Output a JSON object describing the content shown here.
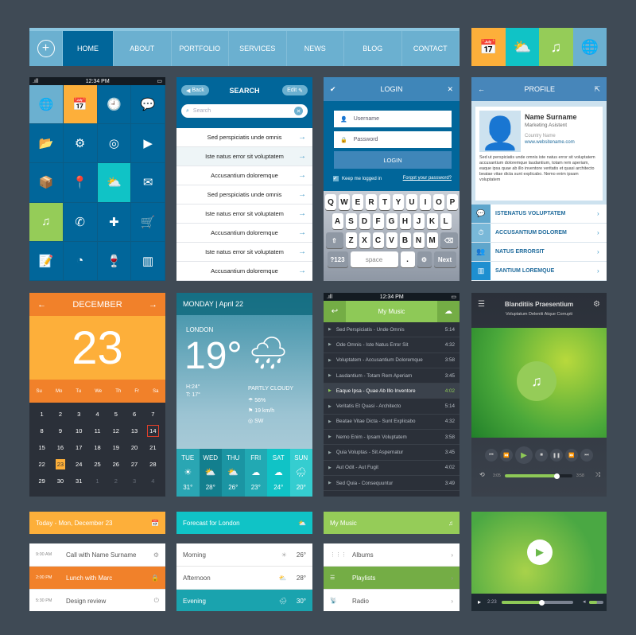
{
  "nav": {
    "items": [
      {
        "label": "HOME",
        "active": true
      },
      {
        "label": "ABOUT"
      },
      {
        "label": "PORTFOLIO"
      },
      {
        "label": "SERVICES"
      },
      {
        "label": "NEWS"
      },
      {
        "label": "BLOG"
      },
      {
        "label": "CONTACT"
      }
    ],
    "plus_icon": "+"
  },
  "tiles": [
    {
      "icon": "calendar-icon",
      "glyph": "📅",
      "color": "#fdaf3a"
    },
    {
      "icon": "weather-icon",
      "glyph": "⛅",
      "color": "#10c3c6"
    },
    {
      "icon": "music-icon",
      "glyph": "♫",
      "color": "#95cc58"
    },
    {
      "icon": "globe-icon",
      "glyph": "🌐",
      "color": "#6bb0d0"
    }
  ],
  "phone": {
    "time": "12:34 PM",
    "signal": ".ıll",
    "battery": "▭"
  },
  "grid_apps": [
    {
      "name": "globe",
      "glyph": "🌐",
      "color": "#6bb0d0"
    },
    {
      "name": "calendar",
      "glyph": "📅",
      "color": "#fdaf3a"
    },
    {
      "name": "clock",
      "glyph": "🕘"
    },
    {
      "name": "chat",
      "glyph": "💬"
    },
    {
      "name": "folder",
      "glyph": "📂"
    },
    {
      "name": "settings",
      "glyph": "⚙"
    },
    {
      "name": "target",
      "glyph": "◎"
    },
    {
      "name": "video",
      "glyph": "▶"
    },
    {
      "name": "box",
      "glyph": "📦"
    },
    {
      "name": "location",
      "glyph": "📍"
    },
    {
      "name": "weather",
      "glyph": "⛅",
      "color": "#10c3c6"
    },
    {
      "name": "mail",
      "glyph": "✉"
    },
    {
      "name": "music",
      "glyph": "♫",
      "color": "#95cc58"
    },
    {
      "name": "phone",
      "glyph": "✆"
    },
    {
      "name": "medkit",
      "glyph": "✚"
    },
    {
      "name": "cart",
      "glyph": "🛒"
    },
    {
      "name": "notes",
      "glyph": "📝"
    },
    {
      "name": "pie-chart",
      "glyph": "◔"
    },
    {
      "name": "wine",
      "glyph": "🍷"
    },
    {
      "name": "bar-chart",
      "glyph": "▥"
    }
  ],
  "search": {
    "back_label": "Back",
    "title": "SEARCH",
    "edit_label": "Edit",
    "placeholder": "Search",
    "results": [
      "Sed perspiciatis unde omnis",
      "Iste natus error sit voluptatem",
      "Accusantium doloremque",
      "Sed perspiciatis unde omnis",
      "Iste natus error sit voluptatem",
      "Accusantium doloremque",
      "Iste natus error sit voluptatem",
      "Accusantium doloremque"
    ]
  },
  "login": {
    "title": "LOGIN",
    "username_placeholder": "Username",
    "password_placeholder": "Password",
    "button": "LOGIN",
    "keep_logged": "Keep me logged in",
    "forgot": "Forgot your password?",
    "keyboard": {
      "row1": [
        "Q",
        "W",
        "E",
        "R",
        "T",
        "Y",
        "U",
        "I",
        "O",
        "P"
      ],
      "row2": [
        "A",
        "S",
        "D",
        "F",
        "G",
        "H",
        "J",
        "K",
        "L"
      ],
      "row3": [
        "Z",
        "X",
        "C",
        "V",
        "B",
        "N",
        "M"
      ],
      "num": "?123",
      "space": "space",
      "dot": ".",
      "next": "Next"
    }
  },
  "profile": {
    "title": "PROFILE",
    "name": "Name Surname",
    "role": "Marketing Asistent",
    "country": "Country Name",
    "website": "www.websitename.com",
    "bio": "Sed ut perspiciatis unde omnis iste natus error sit voluptatem accusantium doloremque laudantium, totam rem aperiam, eaque ipsa quae ab illo inventore veritatis et quasi architecto beatae vitae dicta sunt explicabo. Nemo enim ipsam voluptatem",
    "links": [
      {
        "label": "ISTENATUS VOLUPTATEM",
        "glyph": "💬",
        "color": "#5fa6cc"
      },
      {
        "label": "ACCUSANTIUM DOLOREM",
        "glyph": "⏱",
        "color": "#79b8d8"
      },
      {
        "label": "NATUS ERRORSIT",
        "glyph": "👥",
        "color": "#5fa6cc"
      },
      {
        "label": "SANTIUM LOREMQUE",
        "glyph": "▥",
        "color": "#1e8fd0"
      }
    ]
  },
  "calendar": {
    "month": "DECEMBER",
    "day": "23",
    "weekdays": [
      "Su",
      "Mo",
      "Tu",
      "We",
      "Th",
      "Fr",
      "Sa"
    ],
    "days": [
      "1",
      "2",
      "3",
      "4",
      "5",
      "6",
      "7",
      "8",
      "9",
      "10",
      "11",
      "12",
      "13",
      "14",
      "15",
      "16",
      "17",
      "18",
      "19",
      "20",
      "21",
      "22",
      "23",
      "24",
      "25",
      "26",
      "27",
      "28",
      "29",
      "30",
      "31",
      "1",
      "2",
      "3",
      "4"
    ],
    "selected": "23",
    "marked": "14"
  },
  "weather": {
    "header": "MONDAY | April 22",
    "city": "LONDON",
    "temp": "19°",
    "high": "H:24°",
    "low": "T: 17°",
    "condition": "PARTLY CLOUDY",
    "humidity": "56%",
    "wind": "19 km/h",
    "direction": "SW",
    "forecast": [
      {
        "day": "TUE",
        "temp": "31°",
        "glyph": "☀",
        "color": "#2aa6b3"
      },
      {
        "day": "WED",
        "temp": "28°",
        "glyph": "⛅",
        "color": "#137f8e"
      },
      {
        "day": "THU",
        "temp": "26°",
        "glyph": "⛅",
        "color": "#1b95a3"
      },
      {
        "day": "FRI",
        "temp": "23°",
        "glyph": "☁",
        "color": "#22a9b3"
      },
      {
        "day": "SAT",
        "temp": "24°",
        "glyph": "☁",
        "color": "#10c3c6"
      },
      {
        "day": "SUN",
        "temp": "20°",
        "glyph": "🌧",
        "color": "#35cdd0"
      }
    ]
  },
  "music": {
    "title": "My Music",
    "time": "12:34 PM",
    "tracks": [
      {
        "t": "Sed Perspiciatis - Unde Omnis",
        "d": "5:14"
      },
      {
        "t": "Ode Omnis - Iste Natus Error Sit",
        "d": "4:32"
      },
      {
        "t": "Voluptatem - Accusantium Doloremque",
        "d": "3:58"
      },
      {
        "t": "Laudantium - Totam Rem Aperiam",
        "d": "3:45"
      },
      {
        "t": "Eaque Ipsa - Quae Ab Illo Inventore",
        "d": "4:02",
        "active": true
      },
      {
        "t": "Veritatis Et Quasi - Architecto",
        "d": "5:14"
      },
      {
        "t": "Beatae Vitae Dicta - Sunt Explicabo",
        "d": "4:32"
      },
      {
        "t": "Nemo Enim - Ipsam Voluptatem",
        "d": "3:58"
      },
      {
        "t": "Quia Voluptas - Sit Aspernatur",
        "d": "3:45"
      },
      {
        "t": "Aut Odit - Aut Fugit",
        "d": "4:02"
      },
      {
        "t": "Sed Quia - Consequuntur",
        "d": "3:49"
      }
    ]
  },
  "player": {
    "title": "Blanditiis Praesentium",
    "subtitle": "Voluptatum Deleniti Atque Corrupti",
    "elapsed": "3:05",
    "total": "3:58",
    "progress": 0.77
  },
  "today": {
    "title": "Today - Mon, December 23",
    "color": "#fdaf3a",
    "events": [
      {
        "time": "9:00 AM",
        "title": "Call with Name Surname",
        "glyph": "⚙"
      },
      {
        "time": "2:00 PM",
        "title": "Lunch with Marc",
        "glyph": "🔒",
        "active": true
      },
      {
        "time": "5:30 PM",
        "title": "Design review",
        "glyph": "⏻"
      }
    ]
  },
  "forecast_widget": {
    "title": "Forecast for London",
    "rows": [
      {
        "label": "Morning",
        "temp": "26°",
        "glyph": "☀"
      },
      {
        "label": "Afternoon",
        "temp": "28°",
        "glyph": "⛅"
      },
      {
        "label": "Evening",
        "temp": "30°",
        "glyph": "🌧",
        "active": true
      }
    ]
  },
  "music_widget": {
    "title": "My Music",
    "rows": [
      {
        "label": "Albums",
        "glyph": "⋮⋮⋮"
      },
      {
        "label": "Playlists",
        "glyph": "☰",
        "active": true
      },
      {
        "label": "Radio",
        "glyph": "📡"
      }
    ]
  },
  "video": {
    "time": "2:23",
    "progress": 0.55,
    "volume": 0.55
  }
}
